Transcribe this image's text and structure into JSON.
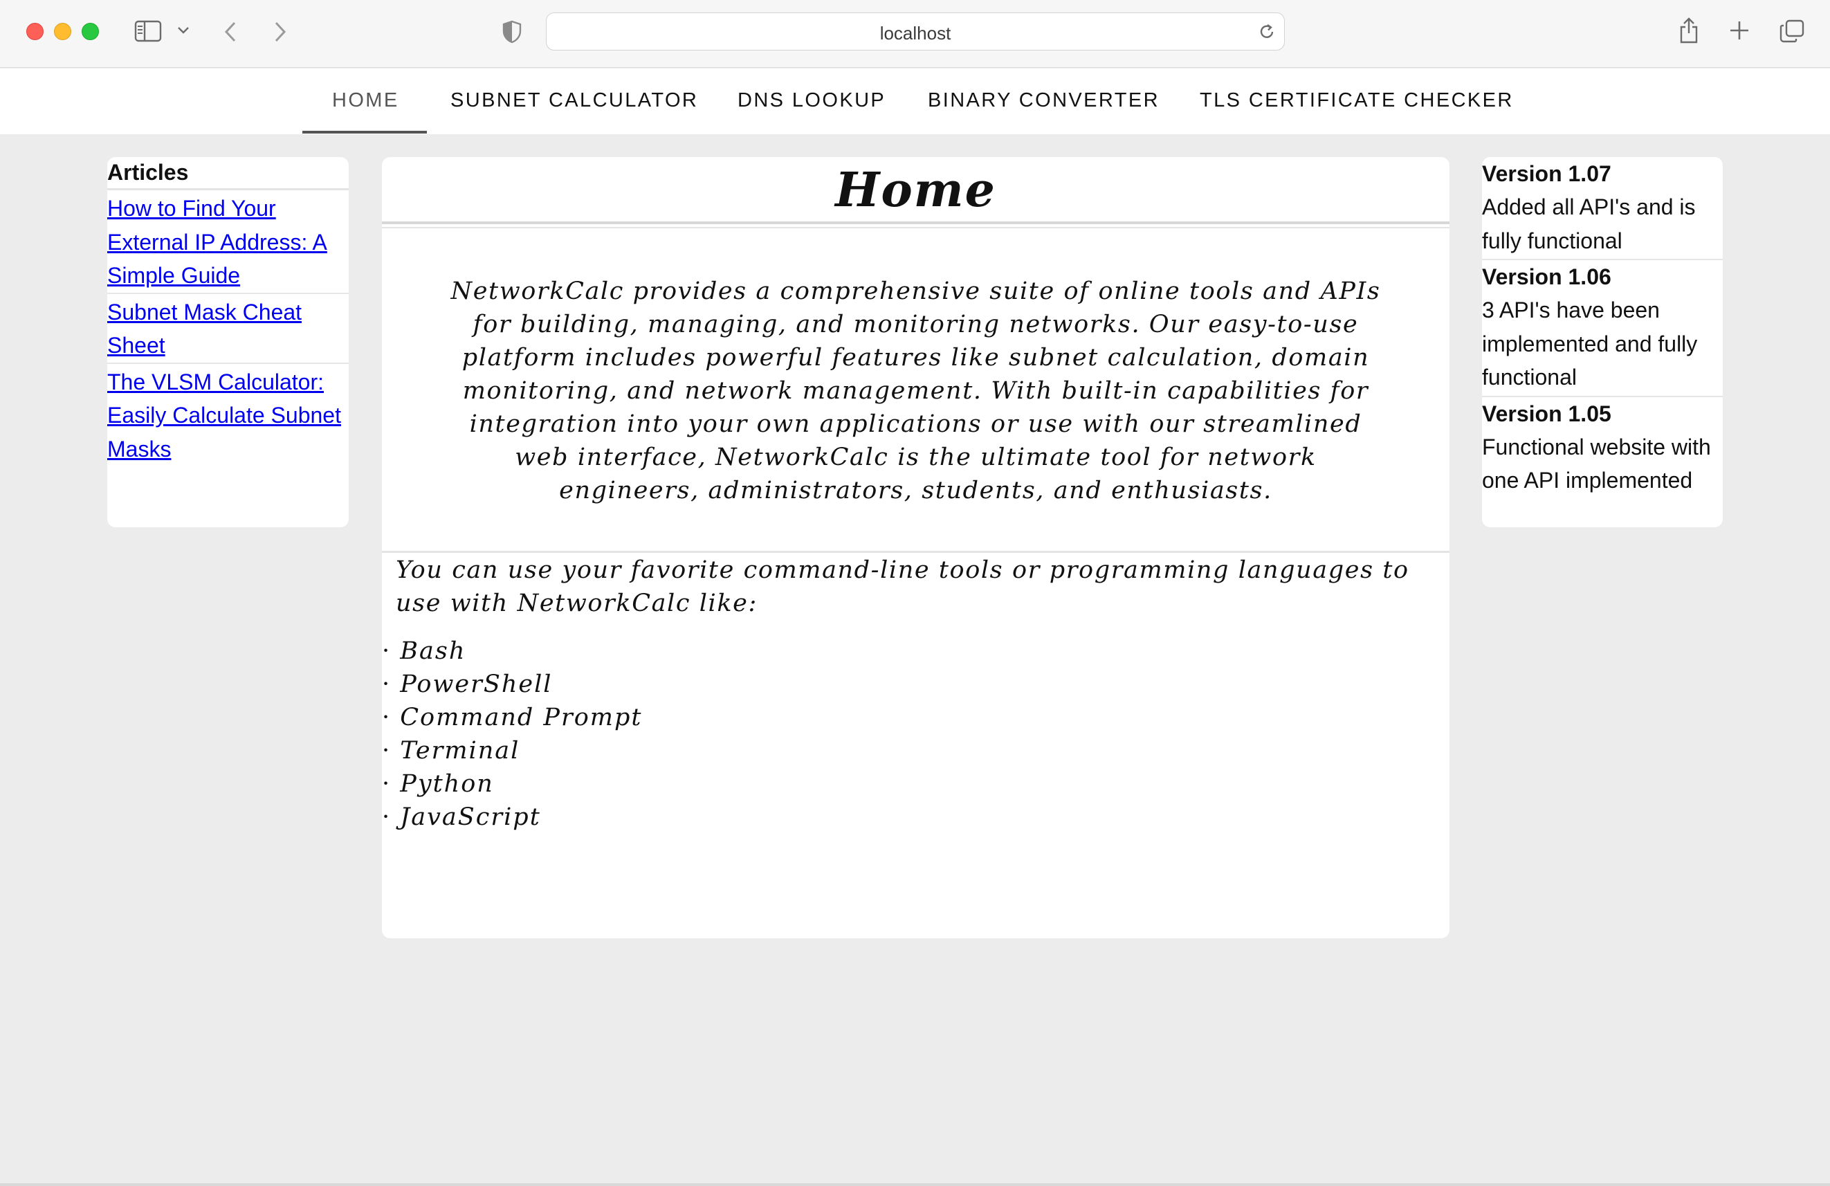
{
  "browser": {
    "url": "localhost"
  },
  "nav": {
    "items": [
      {
        "label": "HOME",
        "active": true
      },
      {
        "label": "SUBNET CALCULATOR"
      },
      {
        "label": "DNS LOOKUP"
      },
      {
        "label": "BINARY CONVERTER"
      },
      {
        "label": "TLS CERTIFICATE CHECKER"
      }
    ]
  },
  "articles": {
    "heading": "Articles",
    "items": [
      {
        "title": "How to Find Your External IP Address: A Simple Guide"
      },
      {
        "title": "Subnet Mask Cheat Sheet"
      },
      {
        "title": "The VLSM Calculator: Easily Calculate Subnet Masks"
      }
    ]
  },
  "main": {
    "title": "Home",
    "intro": "NetworkCalc provides a comprehensive suite of online tools and APIs for building, managing, and monitoring networks. Our easy-to-use platform includes powerful features like subnet calculation, domain monitoring, and network management. With built-in capabilities for integration into your own applications or use with our streamlined web interface, NetworkCalc is the ultimate tool for network engineers, administrators, students, and enthusiasts.",
    "usage": "You can use your favorite command-line tools or programming languages to use with NetworkCalc like:",
    "languages": [
      "Bash",
      "PowerShell",
      "Command Prompt",
      "Terminal",
      "Python",
      "JavaScript"
    ]
  },
  "versions": [
    {
      "title": "Version 1.07",
      "desc": "Added all API's and is fully functional"
    },
    {
      "title": "Version 1.06",
      "desc": "3 API's have been implemented and fully functional"
    },
    {
      "title": "Version 1.05",
      "desc": "Functional website with one API implemented"
    }
  ],
  "colors": {
    "link": "#0000ee",
    "page_bg": "#ececec",
    "panel_bg": "#ffffff",
    "active_nav": "#555555"
  }
}
